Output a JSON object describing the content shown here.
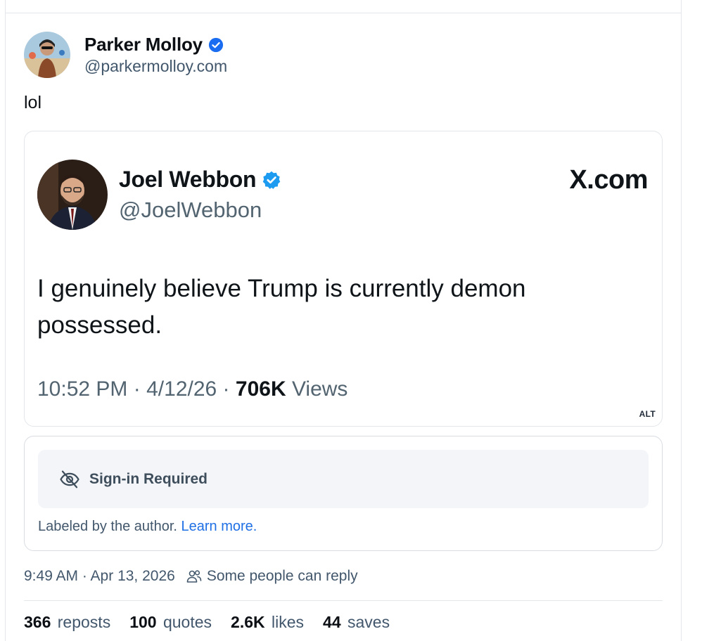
{
  "author": {
    "name": "Parker Molloy",
    "handle": "@parkermolloy.com"
  },
  "post": {
    "text": "lol"
  },
  "embed_image": {
    "author_name": "Joel Webbon",
    "author_handle": "@JoelWebbon",
    "site": "X.com",
    "body": "I genuinely believe Trump is currently demon possessed.",
    "time": "10:52 PM",
    "date": "4/12/26",
    "separator": "·",
    "views_count": "706K",
    "views_label": "Views",
    "alt_badge": "ALT"
  },
  "content_label": {
    "title": "Sign-in Required",
    "note": "Labeled by the author.",
    "link": "Learn more."
  },
  "meta": {
    "timestamp": "9:49 AM · Apr 13, 2026",
    "reply_setting": "Some people can reply"
  },
  "stats": [
    {
      "count": "366",
      "label": "reposts"
    },
    {
      "count": "100",
      "label": "quotes"
    },
    {
      "count": "2.6K",
      "label": "likes"
    },
    {
      "count": "44",
      "label": "saves"
    }
  ],
  "colors": {
    "verified": "#1d9bf0",
    "link": "#1f6fe5",
    "muted": "#42576c"
  },
  "icons": [
    "verified-badge-icon",
    "eye-slash-icon",
    "people-icon"
  ]
}
